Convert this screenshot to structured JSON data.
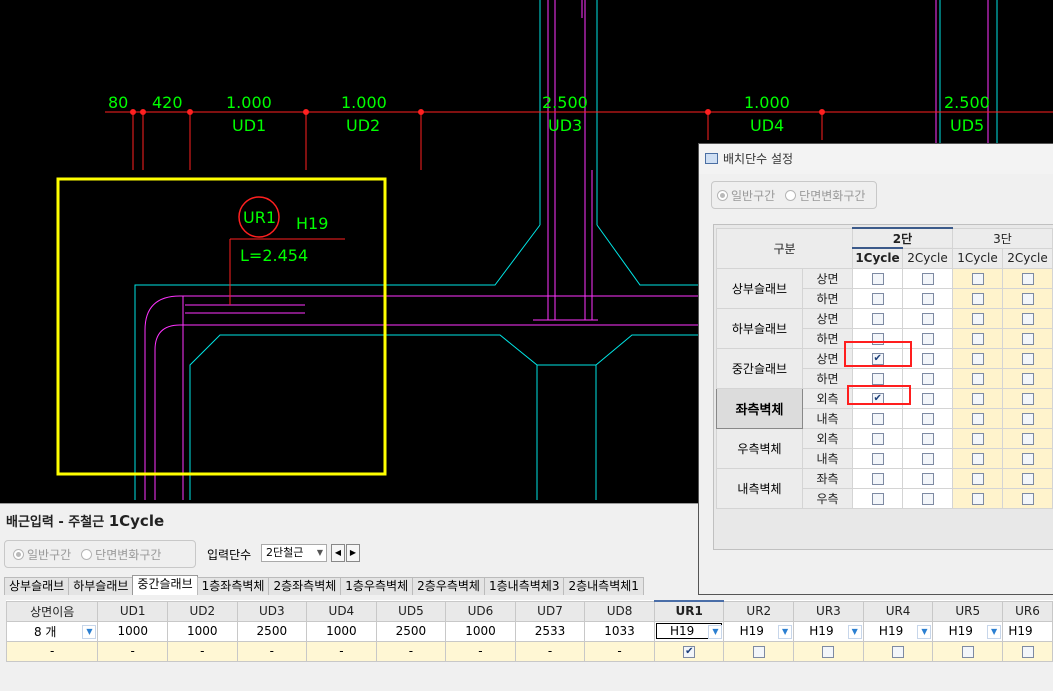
{
  "cad": {
    "dimension_values": [
      "80",
      "420",
      "1.000",
      "1.000",
      "2.500",
      "1.000",
      "2.500"
    ],
    "dimension_labels": [
      "UD1",
      "UD2",
      "UD3",
      "UD4",
      "UD5"
    ],
    "bar_mark": "UR1",
    "bar_size": "H19",
    "bar_length": "L=2.454"
  },
  "bottom": {
    "title_prefix": "배근입력 - 주철근",
    "title_cycle": "1Cycle",
    "radio_general": "일반구간",
    "radio_section_change": "단면변화구간",
    "input_level_label": "입력단수",
    "input_level_value": "2단철근",
    "tabs": [
      "상부슬래브",
      "하부슬래브",
      "중간슬래브",
      "1층좌측벽체",
      "2층좌측벽체",
      "1층우측벽체",
      "2층우측벽체",
      "1층내측벽체3",
      "2층내측벽체1"
    ],
    "active_tab": "중간슬래브",
    "grid": {
      "headers": [
        "상면이음",
        "UD1",
        "UD2",
        "UD3",
        "UD4",
        "UD5",
        "UD6",
        "UD7",
        "UD8",
        "UR1",
        "UR2",
        "UR3",
        "UR4",
        "UR5",
        "UR6"
      ],
      "values": [
        "8 개",
        "1000",
        "1000",
        "2500",
        "1000",
        "2500",
        "1000",
        "2533",
        "1033",
        "H19",
        "H19",
        "H19",
        "H19",
        "H19",
        "H19"
      ],
      "dash": "-"
    }
  },
  "dialog": {
    "title": "배치단수 설정",
    "radio_general": "일반구간",
    "radio_section_change": "단면변화구간",
    "col_group": "구분",
    "level2": "2단",
    "level3": "3단",
    "cycle1": "1Cycle",
    "cycle2": "2Cycle",
    "groups": [
      {
        "name": "상부슬래브",
        "rows": [
          "상면",
          "하면"
        ]
      },
      {
        "name": "하부슬래브",
        "rows": [
          "상면",
          "하면"
        ]
      },
      {
        "name": "중간슬래브",
        "rows": [
          "상면",
          "하면"
        ]
      },
      {
        "name": "좌측벽체",
        "rows": [
          "외측",
          "내측"
        ]
      },
      {
        "name": "우측벽체",
        "rows": [
          "외측",
          "내측"
        ]
      },
      {
        "name": "내측벽체",
        "rows": [
          "좌측",
          "우측"
        ]
      }
    ]
  }
}
